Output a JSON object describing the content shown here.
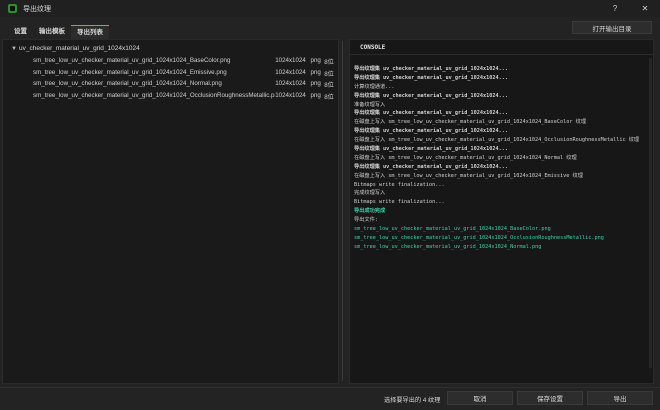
{
  "window": {
    "title": "导出纹理",
    "help_label": "?",
    "close_label": "✕"
  },
  "tabs": [
    {
      "label": "设置"
    },
    {
      "label": "输出模板"
    },
    {
      "label": "导出列表"
    }
  ],
  "toolbar": {
    "open_dir_label": "打开输出目录"
  },
  "tree": {
    "root_label": "uv_checker_material_uv_grid_1024x1024",
    "files": [
      {
        "name": "sm_tree_low_uv_checker_material_uv_grid_1024x1024_BaseColor.png",
        "resolution": "1024x1024",
        "format": "png",
        "bit": "8位"
      },
      {
        "name": "sm_tree_low_uv_checker_material_uv_grid_1024x1024_Emissive.png",
        "resolution": "1024x1024",
        "format": "png",
        "bit": "8位"
      },
      {
        "name": "sm_tree_low_uv_checker_material_uv_grid_1024x1024_Normal.png",
        "resolution": "1024x1024",
        "format": "png",
        "bit": "8位"
      },
      {
        "name": "sm_tree_low_uv_checker_material_uv_grid_1024x1024_OcclusionRoughnessMetallic.png",
        "resolution": "1024x1024",
        "format": "png",
        "bit": "8位"
      }
    ]
  },
  "console": {
    "header": "CONSOLE",
    "lines": [
      {
        "text": "导出纹理集 uv_checker_material_uv_grid_1024x1024...",
        "style": "mixed"
      },
      {
        "text": "导出纹理集 uv_checker_material_uv_grid_1024x1024...",
        "style": "mixed"
      },
      {
        "text": "计算纹理通道...",
        "style": "normal"
      },
      {
        "text": "导出纹理集 uv_checker_material_uv_grid_1024x1024...",
        "style": "mixed"
      },
      {
        "text": "准备纹理写入",
        "style": "normal"
      },
      {
        "text": "导出纹理集 uv_checker_material_uv_grid_1024x1024...",
        "style": "mixed"
      },
      {
        "text": "在磁盘上写入 sm_tree_low_uv_checker_material_uv_grid_1024x1024_BaseColor 纹理",
        "style": "normal"
      },
      {
        "text": "导出纹理集 uv_checker_material_uv_grid_1024x1024...",
        "style": "mixed"
      },
      {
        "text": "在磁盘上写入 sm_tree_low_uv_checker_material_uv_grid_1024x1024_OcclusionRoughnessMetallic 纹理",
        "style": "normal"
      },
      {
        "text": "导出纹理集 uv_checker_material_uv_grid_1024x1024...",
        "style": "mixed"
      },
      {
        "text": "在磁盘上写入 sm_tree_low_uv_checker_material_uv_grid_1024x1024_Normal 纹理",
        "style": "normal"
      },
      {
        "text": "导出纹理集 uv_checker_material_uv_grid_1024x1024...",
        "style": "mixed"
      },
      {
        "text": "在磁盘上写入 sm_tree_low_uv_checker_material_uv_grid_1024x1024_Emissive 纹理",
        "style": "normal"
      },
      {
        "text": "Bitmaps write finalization...",
        "style": "normal"
      },
      {
        "text": "完成纹理写入",
        "style": "normal"
      },
      {
        "text": "Bitmaps write finalization...",
        "style": "normal"
      },
      {
        "text": "导出成功完成",
        "style": "green-bold"
      },
      {
        "text": "导出文件:",
        "style": "normal"
      },
      {
        "text": "sm_tree_low_uv_checker_material_uv_grid_1024x1024_BaseColor.png",
        "style": "green"
      },
      {
        "text": "sm_tree_low_uv_checker_material_uv_grid_1024x1024_OcclusionRoughnessMetallic.png",
        "style": "green"
      },
      {
        "text": "sm_tree_low_uv_checker_material_uv_grid_1024x1024_Normal.png",
        "style": "green"
      }
    ]
  },
  "footer": {
    "status_text": "选择要导出的 4 纹理",
    "cancel_label": "取消",
    "save_settings_label": "保存设置",
    "export_label": "导出"
  },
  "colors": {
    "accent": "#5aa0ff",
    "success": "#3fd0a8",
    "app_icon": "#2f8f2f"
  }
}
